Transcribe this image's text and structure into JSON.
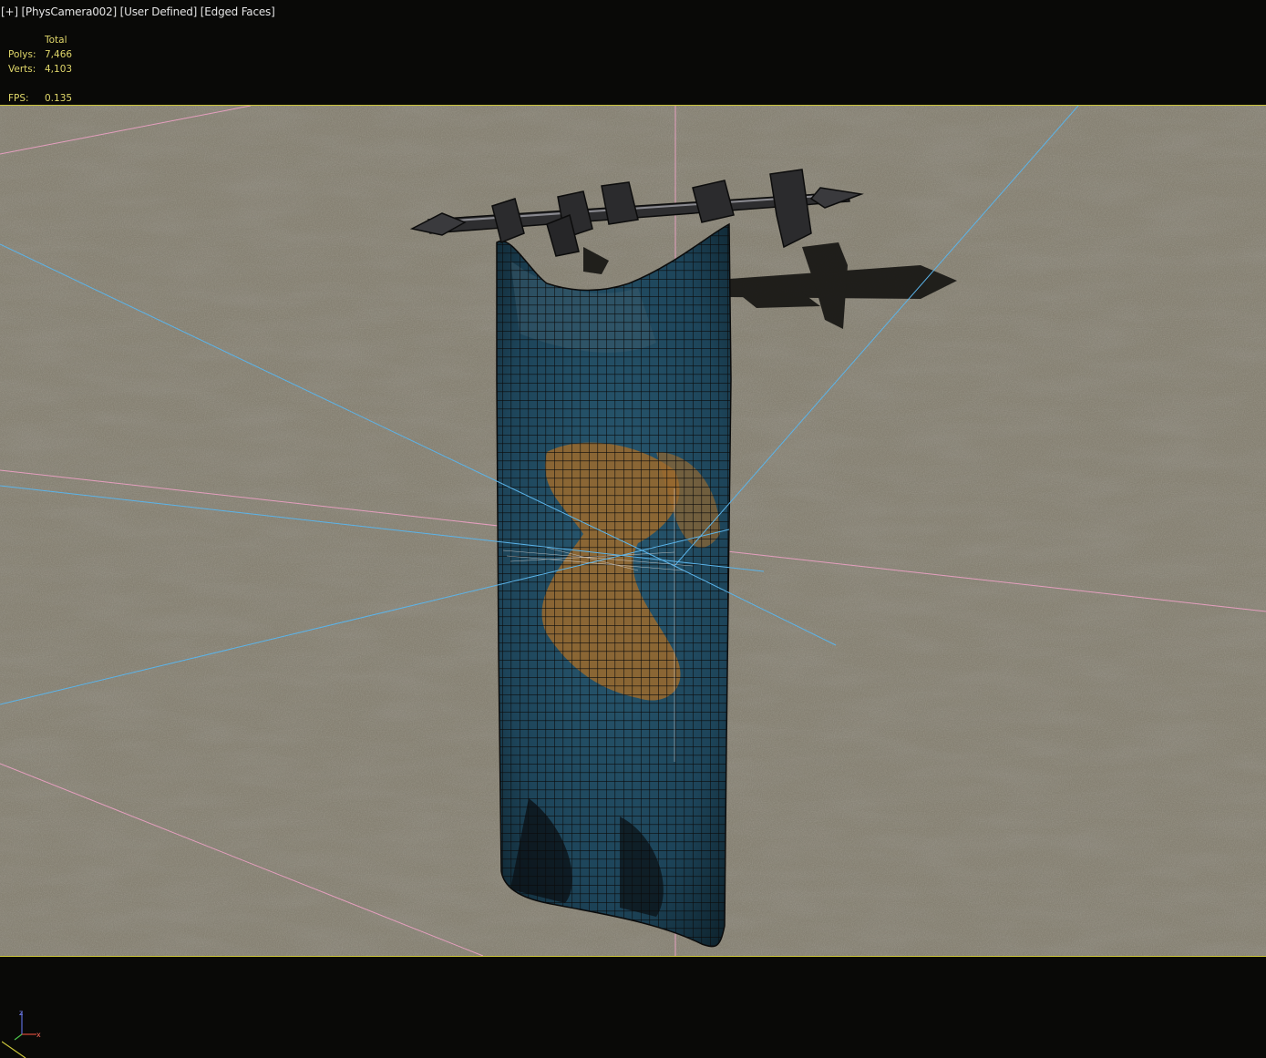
{
  "viewport": {
    "menu": {
      "plus": "[+]",
      "camera": "[PhysCamera002]",
      "shading": "[User Defined]",
      "edges": "[Edged Faces]"
    },
    "stats": {
      "header": "Total",
      "polys_label": "Polys:",
      "polys_value": "7,466",
      "verts_label": "Verts:",
      "verts_value": "4,103",
      "fps_label": "FPS:",
      "fps_value": "0.135"
    },
    "colors": {
      "active_border": "#c9c33a",
      "background": "#090907",
      "wall": "#858072",
      "light_line": "#5bb4ea",
      "camera_line": "#e59fbf",
      "stats_text": "#e0d76a",
      "banner_blue": "#1f4b63",
      "banner_gold": "#9c6a2c"
    },
    "axis_gizmo": {
      "z": "z",
      "x": "x"
    }
  }
}
